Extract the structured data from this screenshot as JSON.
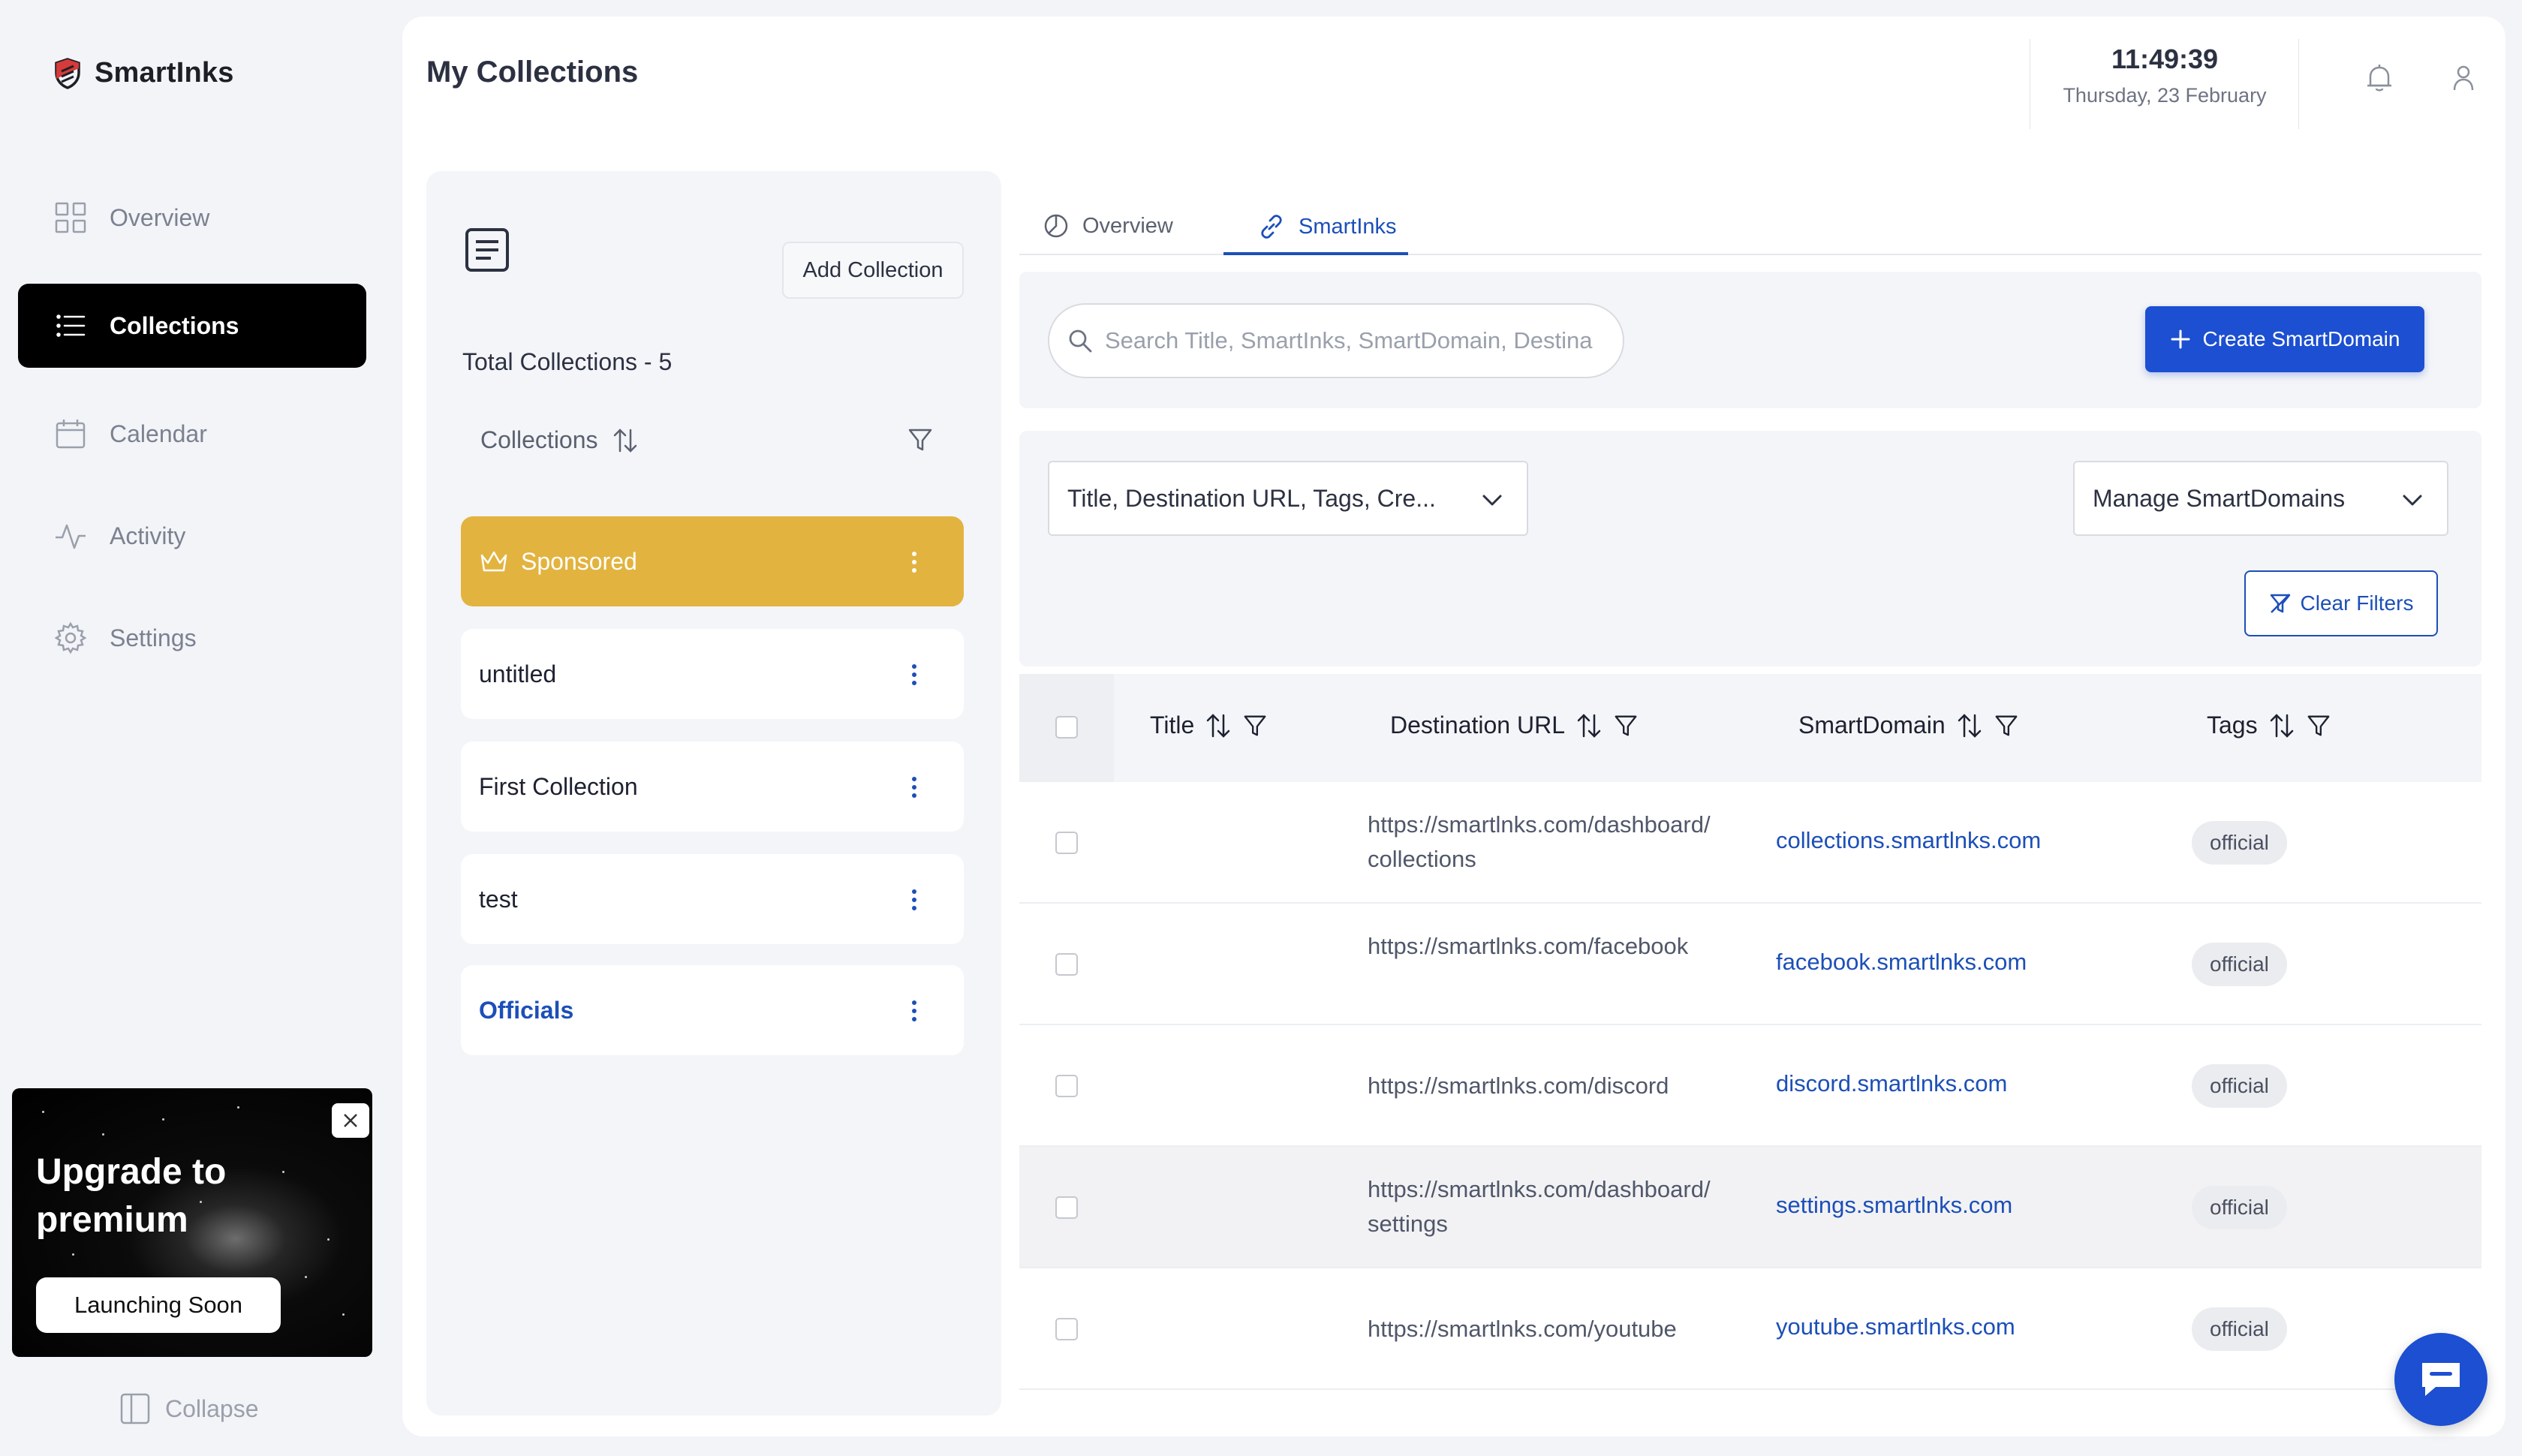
{
  "app": {
    "name": "SmartInks"
  },
  "sidebar": {
    "items": [
      {
        "label": "Overview",
        "icon": "grid-icon"
      },
      {
        "label": "Collections",
        "icon": "list-icon",
        "active": true
      },
      {
        "label": "Calendar",
        "icon": "calendar-icon"
      },
      {
        "label": "Activity",
        "icon": "activity-icon"
      },
      {
        "label": "Settings",
        "icon": "gear-icon"
      }
    ],
    "premium": {
      "title": "Upgrade to premium",
      "button": "Launching Soon"
    },
    "collapse_label": "Collapse"
  },
  "header": {
    "title": "My Collections",
    "time": "11:49:39",
    "date": "Thursday, 23 February"
  },
  "collections": {
    "add_button": "Add Collection",
    "total_label": "Total Collections - 5",
    "header_label": "Collections",
    "items": [
      {
        "label": "Sponsored"
      },
      {
        "label": "untitled"
      },
      {
        "label": "First Collection"
      },
      {
        "label": "test"
      },
      {
        "label": "Officials"
      }
    ]
  },
  "tabs": [
    {
      "label": "Overview"
    },
    {
      "label": "SmartInks",
      "active": true
    }
  ],
  "toolbar": {
    "search_placeholder": "Search Title, SmartInks, SmartDomain, Destina",
    "create_button": "Create SmartDomain",
    "columns_select": "Title, Destination URL, Tags, Cre...",
    "manage_select": "Manage SmartDomains",
    "clear_filters": "Clear Filters"
  },
  "table": {
    "columns": [
      "Title",
      "Destination URL",
      "SmartDomain",
      "Tags"
    ],
    "rows": [
      {
        "title": "",
        "url": "https://smartlnks.com/dashboard/collections",
        "domain": "collections.smartlnks.com",
        "tag": "official"
      },
      {
        "title": "",
        "url": "https://smartlnks.com/facebook",
        "domain": "facebook.smartlnks.com",
        "tag": "official"
      },
      {
        "title": "",
        "url": "https://smartlnks.com/discord",
        "domain": "discord.smartlnks.com",
        "tag": "official"
      },
      {
        "title": "",
        "url": "https://smartlnks.com/dashboard/settings",
        "domain": "settings.smartlnks.com",
        "tag": "official"
      },
      {
        "title": "",
        "url": "https://smartlnks.com/youtube",
        "domain": "youtube.smartlnks.com",
        "tag": "official"
      }
    ]
  },
  "colors": {
    "accent": "#1c4fd1",
    "sponsored": "#e2b33f",
    "active_nav": "#000000"
  }
}
